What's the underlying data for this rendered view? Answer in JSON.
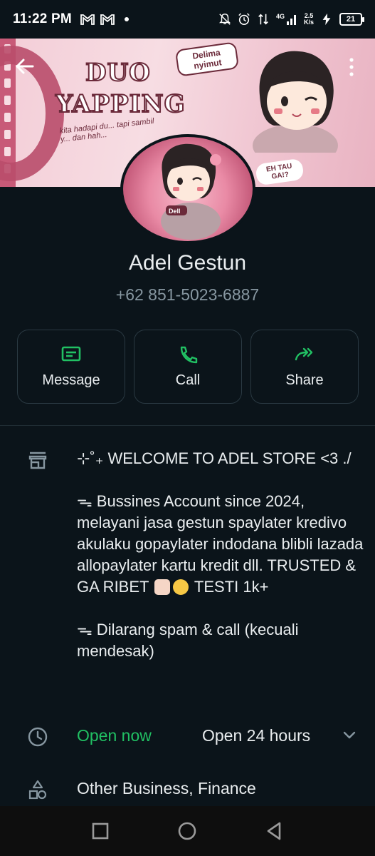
{
  "status_bar": {
    "time": "11:22 PM",
    "network_speed_top": "2.5",
    "network_speed_bottom": "K/s",
    "network_type": "4G",
    "battery": "21"
  },
  "cover": {
    "title_line1": "DUO",
    "title_line2": "YAPPING",
    "tagline": "kita hadapi du... tapi sambil y... dan hah...",
    "sticker_top": "Delima nyimut",
    "sticker_bottom": "EH TAU GA!?",
    "avatar_label": "Dell"
  },
  "profile": {
    "name": "Adel Gestun",
    "phone": "+62 851-5023-6887"
  },
  "actions": [
    {
      "label": "Message",
      "icon": "message-icon"
    },
    {
      "label": "Call",
      "icon": "phone-icon"
    },
    {
      "label": "Share",
      "icon": "share-icon"
    }
  ],
  "description": {
    "line1": "⊹˚₊ WELCOME TO ADEL STORE <3 ./",
    "line2a": "ᯓ Bussines Account since 2024, melayani jasa gestun spaylater kredivo akulaku gopaylater indodana blibli lazada allopaylater kartu kredit dll. TRUSTED & GA RIBET",
    "line2b": "TESTI 1k+",
    "line3": "ᯓ Dilarang spam & call (kecuali mendesak)"
  },
  "hours": {
    "status": "Open now",
    "detail": "Open 24 hours"
  },
  "category": "Other Business, Finance",
  "colors": {
    "background": "#0b141a",
    "accent_green": "#21c063",
    "border": "#2a3942",
    "secondary_text": "#8696a0"
  }
}
